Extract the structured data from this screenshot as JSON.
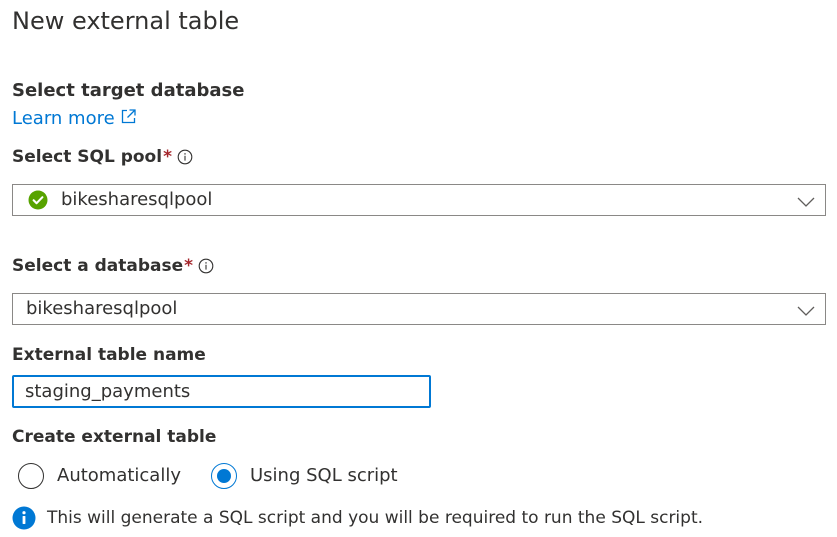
{
  "header": {
    "title": "New external table"
  },
  "target_section": {
    "title": "Select target database",
    "learn_more_label": "Learn more"
  },
  "sql_pool": {
    "label": "Select SQL pool",
    "required_mark": "*",
    "selected_value": "bikesharesqlpool",
    "status_icon": "success-check-icon",
    "status_color": "#57a300"
  },
  "database": {
    "label": "Select a database",
    "required_mark": "*",
    "selected_value": "bikesharesqlpool"
  },
  "table_name": {
    "label": "External table name",
    "value": "staging_payments"
  },
  "create_method": {
    "label": "Create external table",
    "options": [
      {
        "label": "Automatically",
        "selected": false
      },
      {
        "label": "Using SQL script",
        "selected": true
      }
    ]
  },
  "info_message": {
    "icon": "info-filled-icon",
    "text": "This will generate a SQL script and you will be required to run the SQL script."
  },
  "colors": {
    "accent": "#0078d4",
    "required": "#a4262c",
    "text": "#323130",
    "border": "#8a8886"
  }
}
